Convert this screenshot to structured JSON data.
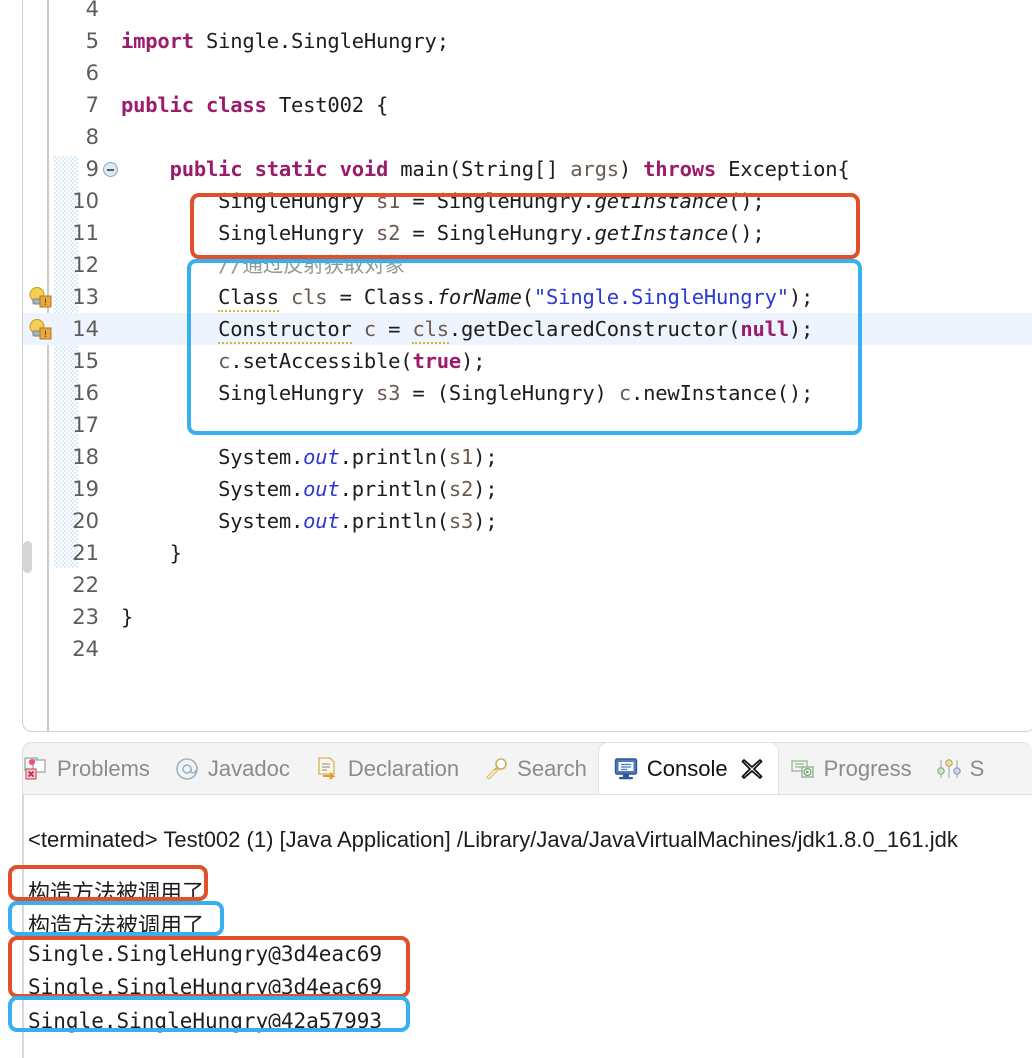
{
  "editor": {
    "first_line": 4,
    "fold_marker_line": 9,
    "warning_lines": [
      13,
      14
    ],
    "highlighted_line": 14,
    "lines": [
      {
        "n": 4,
        "text": ""
      },
      {
        "n": 5,
        "text": "import Single.SingleHungry;"
      },
      {
        "n": 6,
        "text": ""
      },
      {
        "n": 7,
        "text": "public class Test002 {"
      },
      {
        "n": 8,
        "text": ""
      },
      {
        "n": 9,
        "text": "    public static void main(String[] args) throws Exception{"
      },
      {
        "n": 10,
        "text": "        SingleHungry s1 = SingleHungry.getInstance();"
      },
      {
        "n": 11,
        "text": "        SingleHungry s2 = SingleHungry.getInstance();"
      },
      {
        "n": 12,
        "text": "        //通过反射获取对象"
      },
      {
        "n": 13,
        "text": "        Class cls = Class.forName(\"Single.SingleHungry\");"
      },
      {
        "n": 14,
        "text": "        Constructor c = cls.getDeclaredConstructor(null);"
      },
      {
        "n": 15,
        "text": "        c.setAccessible(true);"
      },
      {
        "n": 16,
        "text": "        SingleHungry s3 = (SingleHungry) c.newInstance();"
      },
      {
        "n": 17,
        "text": ""
      },
      {
        "n": 18,
        "text": "        System.out.println(s1);"
      },
      {
        "n": 19,
        "text": "        System.out.println(s2);"
      },
      {
        "n": 20,
        "text": "        System.out.println(s3);"
      },
      {
        "n": 21,
        "text": "    }"
      },
      {
        "n": 22,
        "text": ""
      },
      {
        "n": 23,
        "text": "}"
      },
      {
        "n": 24,
        "text": ""
      }
    ]
  },
  "annotations": {
    "code_red_box": {
      "covers_lines": "10-11",
      "color": "#e0502a"
    },
    "code_blue_box": {
      "covers_lines": "12-16",
      "color": "#38b0ef"
    },
    "console_red_box_1": {
      "covers": "构造方法被调用了",
      "color": "#e0502a"
    },
    "console_blue_box_1": {
      "covers": "构造方法被调用了",
      "color": "#38b0ef"
    },
    "console_red_box_2": {
      "covers": "Single.SingleHungry@3d4eac69 x2",
      "color": "#e0502a"
    },
    "console_blue_box_2": {
      "covers": "Single.SingleHungry@42a57993",
      "color": "#38b0ef"
    }
  },
  "panel": {
    "tabs": [
      {
        "label": "Problems",
        "icon": "problems-icon",
        "active": false,
        "closable": false
      },
      {
        "label": "Javadoc",
        "icon": "javadoc-icon",
        "active": false,
        "closable": false
      },
      {
        "label": "Declaration",
        "icon": "declaration-icon",
        "active": false,
        "closable": false
      },
      {
        "label": "Search",
        "icon": "search-icon",
        "active": false,
        "closable": false
      },
      {
        "label": "Console",
        "icon": "console-icon",
        "active": true,
        "closable": true
      },
      {
        "label": "Progress",
        "icon": "progress-icon",
        "active": false,
        "closable": false
      },
      {
        "label": "S",
        "icon": "servers-icon",
        "active": false,
        "closable": false
      }
    ],
    "close_label": "✕"
  },
  "console": {
    "terminated_line": "<terminated> Test002 (1) [Java Application] /Library/Java/JavaVirtualMachines/jdk1.8.0_161.jdk",
    "output": [
      "构造方法被调用了",
      "构造方法被调用了",
      "Single.SingleHungry@3d4eac69",
      "Single.SingleHungry@3d4eac69",
      "Single.SingleHungry@42a57993"
    ]
  },
  "colors": {
    "accent_red": "#e0502a",
    "accent_blue": "#38b0ef",
    "keyword": "#9a1c6b",
    "string": "#2a3ad0",
    "comment": "#8c9b95",
    "line_highlight": "#eef4fd"
  }
}
